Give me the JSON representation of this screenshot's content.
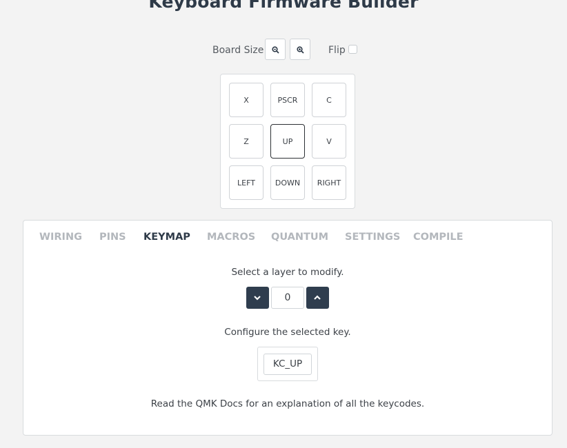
{
  "header": {
    "title": "Keyboard Firmware Builder"
  },
  "toolbar": {
    "board_size_label": "Board Size",
    "zoom_out_icon": "zoom-out-icon",
    "zoom_in_icon": "zoom-in-icon",
    "flip_label": "Flip",
    "flip_checked": false
  },
  "board": {
    "keys": [
      "X",
      "PSCR",
      "C",
      "Z",
      "UP",
      "V",
      "LEFT",
      "DOWN",
      "RIGHT"
    ],
    "selected_key": "UP"
  },
  "tabs": [
    "WIRING",
    "PINS",
    "KEYMAP",
    "MACROS",
    "QUANTUM",
    "SETTINGS",
    "COMPILE"
  ],
  "active_tab": "KEYMAP",
  "keymap": {
    "layer_prompt": "Select a layer to modify.",
    "layer_value": "0",
    "layer_down_icon": "chevron-down-icon",
    "layer_up_icon": "chevron-up-icon",
    "key_prompt": "Configure the selected key.",
    "keycode_value": "KC_UP",
    "docs_text": "Read the QMK Docs for an explanation of all the keycodes."
  },
  "colors": {
    "accent": "#2f3d4e",
    "background": "#f3f3f3",
    "tab_inactive": "#b3b7bc"
  }
}
